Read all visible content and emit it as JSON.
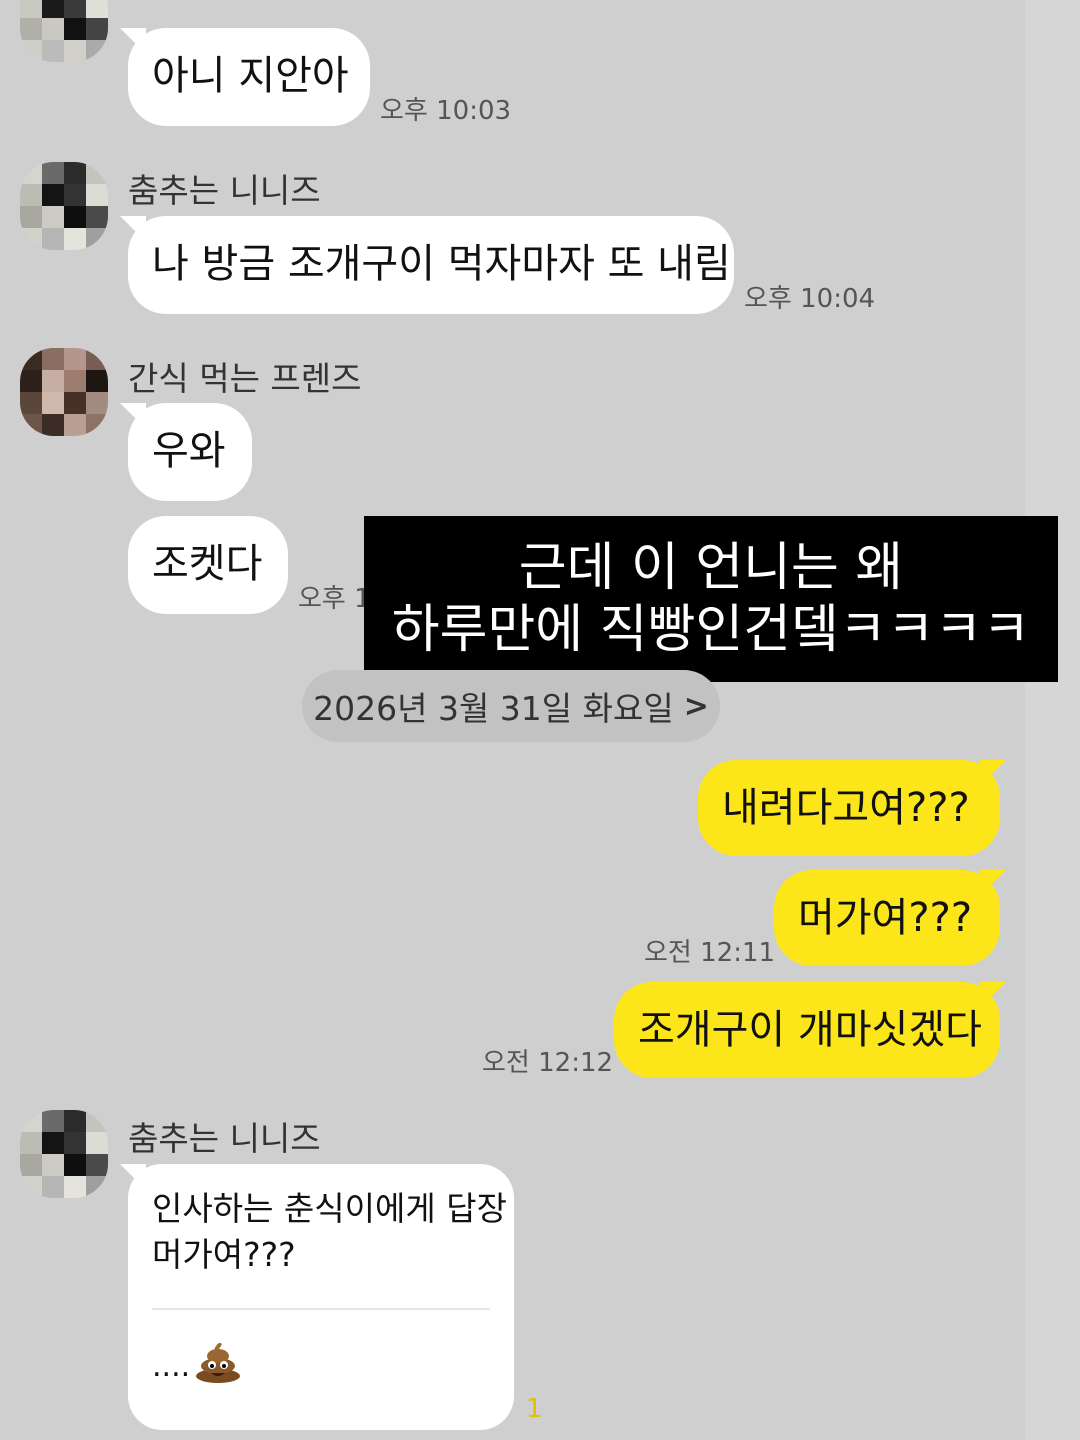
{
  "overlay": {
    "line1": "근데 이 언니는 왜",
    "line2": "하루만에 직빵인건뎈ㅋㅋㅋㅋ"
  },
  "messages": {
    "m1": {
      "text": "아니 지안아",
      "time": "오후 10:03"
    },
    "m2": {
      "sender": "춤추는 니니즈",
      "text": "나 방금 조개구이 먹자마자 또 내림",
      "time": "오후 10:04"
    },
    "m3": {
      "sender": "간식 먹는 프렌즈",
      "text1": "우와",
      "text2": "조켓다",
      "time": "오후 1"
    },
    "date_divider": "2026년 3월 31일 화요일",
    "mine": [
      {
        "text": "내려다고여???"
      },
      {
        "text": "머가여???",
        "time": "오전 12:11"
      },
      {
        "text": "조개구이 개마싯겠다",
        "time": "오전 12:12"
      }
    ],
    "m4": {
      "sender": "춤추는 니니즈",
      "line1": "인사하는 춘식이에게 답장",
      "line2": "머가여???",
      "footer": "....",
      "unread": "1"
    }
  },
  "icons": {
    "poop": "poop-emoji-icon",
    "chevron": "chevron-right-icon"
  },
  "colors": {
    "background": "#cfcfcf",
    "my_bubble": "#fce61a",
    "their_bubble": "#ffffff"
  }
}
